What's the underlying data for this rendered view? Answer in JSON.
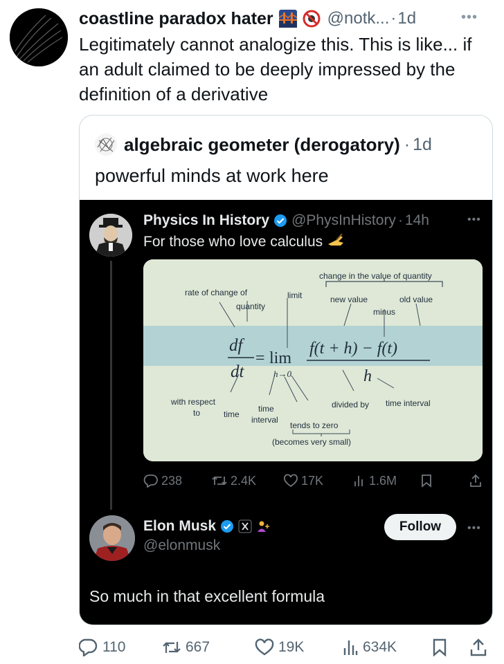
{
  "outer": {
    "name": "coastline paradox hater",
    "handle": "@notk...",
    "sep": "·",
    "time": "1d",
    "text": "Legitimately cannot analogize this. This is like... if an adult claimed to be deeply impressed by the definition of a derivative",
    "actions": {
      "reply": "110",
      "retweet": "667",
      "like": "19K",
      "views": "634K"
    }
  },
  "quote": {
    "name": "algebraic geometer (derogatory)",
    "sep": "·",
    "time": "1d",
    "text": "powerful minds at work here"
  },
  "physics": {
    "name": "Physics In History",
    "handle": "@PhysInHistory",
    "sep": "·",
    "time": "14h",
    "text": "For those who love calculus",
    "actions": {
      "reply": "238",
      "retweet": "2.4K",
      "like": "17K",
      "views": "1.6M"
    }
  },
  "formula": {
    "change_in_value": "change in the value of quantity",
    "rate_of_change": "rate of change of",
    "quantity": "quantity",
    "limit": "limit",
    "new_value": "new value",
    "old_value": "old value",
    "minus": "minus",
    "df": "df",
    "dt": "dt",
    "eq": "=",
    "lim": "lim",
    "sub": "h→0",
    "numerator": "f(t + h) − f(t)",
    "denominator": "h",
    "with_respect": "with respect",
    "to": "to",
    "time1": "time",
    "time2": "time",
    "interval": "interval",
    "divided_by": "divided by",
    "time_interval": "time interval",
    "tends_to_zero": "tends to zero",
    "becomes_small": "(becomes very small)"
  },
  "elon": {
    "name": "Elon Musk",
    "handle": "@elonmusk",
    "follow": "Follow",
    "text": "So much in that excellent formula"
  },
  "colors": {
    "verified_blue": "#1d9bf0",
    "dark_bg": "#000000",
    "formula_bg": "#dfe8d6",
    "formula_band": "#b3d2d3"
  }
}
